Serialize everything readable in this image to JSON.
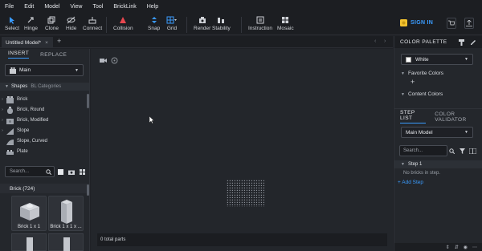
{
  "menu": [
    "File",
    "Edit",
    "Model",
    "View",
    "Tool",
    "BrickLink",
    "Help"
  ],
  "toolbar": {
    "select": "Select",
    "hinge": "Hinge",
    "clone": "Clone",
    "hide": "Hide",
    "connect": "Connect",
    "collision": "Collision",
    "snap": "Snap",
    "grid": "Grid",
    "render": "Render",
    "stability": "Stability",
    "instruction": "Instruction",
    "mosaic": "Mosaic"
  },
  "account": {
    "signin": "SIGN IN"
  },
  "doc_tab": {
    "title": "Untitled Model*",
    "close": "×",
    "add": "+"
  },
  "left_panel": {
    "tab_insert": "INSERT",
    "tab_replace": "REPLACE",
    "set_value": "Main",
    "categories_header": "Shapes",
    "categories_alt": "BL Categories",
    "categories": [
      {
        "label": "Brick",
        "has_children": true
      },
      {
        "label": "Brick, Round",
        "has_children": true
      },
      {
        "label": "Brick, Modified",
        "has_children": true
      },
      {
        "label": "Slope",
        "has_children": true
      },
      {
        "label": "Slope, Curved",
        "has_children": false
      },
      {
        "label": "Plate",
        "has_children": false
      }
    ],
    "search_placeholder": "Search...",
    "group_title": "Brick (724)",
    "parts": [
      {
        "label": "Brick 1 x 1"
      },
      {
        "label": "Brick 1 x 1 x ..."
      }
    ]
  },
  "canvas": {
    "status": "0 total parts"
  },
  "right_panel": {
    "color_palette_title": "COLOR PALETTE",
    "current_color": "White",
    "current_color_hex": "#ffffff",
    "favorite_colors": "Favorite Colors",
    "add": "+",
    "content_colors": "Content Colors",
    "tab_step_list": "STEP LIST",
    "tab_color_validator": "COLOR VALIDATOR",
    "model_value": "Main Model",
    "search_placeholder": "Search...",
    "step_label": "Step 1",
    "no_bricks": "No bricks in step.",
    "add_step": "+ Add Step"
  },
  "colors": {
    "accent": "#3a9cff",
    "collision": "#e8474f",
    "brick_yellow": "#f2c12e"
  }
}
